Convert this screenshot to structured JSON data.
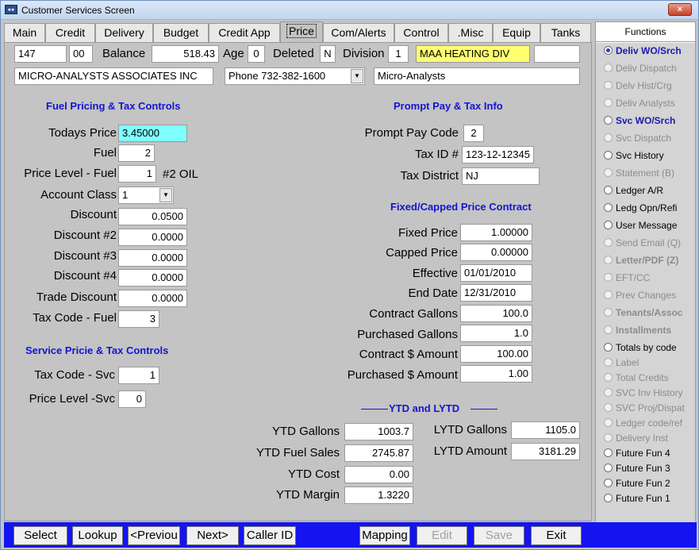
{
  "window": {
    "title": "Customer Services Screen",
    "close": "×"
  },
  "tabs": [
    {
      "label": "Main"
    },
    {
      "label": "Credit"
    },
    {
      "label": "Delivery"
    },
    {
      "label": "Budget"
    },
    {
      "label": "Credit App"
    },
    {
      "label": "Price"
    },
    {
      "label": "Com/Alerts"
    },
    {
      "label": "Control"
    },
    {
      "label": ".Misc"
    },
    {
      "label": "Equip"
    },
    {
      "label": "Tanks"
    }
  ],
  "active_tab": "Price",
  "header": {
    "account": "147",
    "sub": "00",
    "balance_label": "Balance",
    "balance": "518.43",
    "age_label": "Age",
    "age": "0",
    "deleted_label": "Deleted",
    "deleted": "N",
    "division_label": "Division",
    "division": "1",
    "division_name": "MAA HEATING  DIV",
    "customer_name": "MICRO-ANALYSTS ASSOCIATES INC",
    "phone": "Phone 732-382-1600",
    "short_name": "Micro-Analysts"
  },
  "fuel": {
    "heading": "Fuel Pricing & Tax Controls",
    "todays_price_label": "Todays Price",
    "todays_price": "3.45000",
    "fuel_label": "Fuel",
    "fuel": "2",
    "price_level_label": "Price Level - Fuel",
    "price_level": "1",
    "fuel_name": "#2 OIL",
    "account_class_label": "Account Class",
    "account_class": "1",
    "discount_label": "Discount",
    "discount": "0.0500",
    "discount2_label": "Discount #2",
    "discount2": "0.0000",
    "discount3_label": "Discount #3",
    "discount3": "0.0000",
    "discount4_label": "Discount #4",
    "discount4": "0.0000",
    "trade_discount_label": "Trade Discount",
    "trade_discount": "0.0000",
    "tax_code_label": "Tax Code - Fuel",
    "tax_code": "3"
  },
  "service": {
    "heading": "Service Pricie & Tax Controls",
    "tax_code_label": "Tax Code - Svc",
    "tax_code": "1",
    "price_level_label": "Price Level -Svc",
    "price_level": "0"
  },
  "prompt": {
    "heading": "Prompt Pay & Tax Info",
    "code_label": "Prompt Pay Code",
    "code": "2",
    "tax_id_label": "Tax ID #",
    "tax_id": "123-12-12345",
    "tax_district_label": "Tax District",
    "tax_district": "NJ"
  },
  "contract": {
    "heading": "Fixed/Capped Price Contract",
    "fixed_label": "Fixed Price",
    "fixed": "1.00000",
    "capped_label": "Capped Price",
    "capped": "0.00000",
    "effective_label": "Effective",
    "effective": "01/01/2010",
    "end_label": "End Date",
    "end": "12/31/2010",
    "gallons_label": "Contract Gallons",
    "gallons": "100.0",
    "purchased_gallons_label": "Purchased Gallons",
    "purchased_gallons": "1.0",
    "amount_label": "Contract $ Amount",
    "amount": "100.00",
    "purchased_amount_label": "Purchased $ Amount",
    "purchased_amount": "1.00"
  },
  "ytd": {
    "heading": "YTD and LYTD",
    "gallons_label": "YTD Gallons",
    "gallons": "1003.7",
    "fuel_sales_label": "YTD Fuel Sales",
    "fuel_sales": "2745.87",
    "cost_label": "YTD Cost",
    "cost": "0.00",
    "margin_label": "YTD Margin",
    "margin": "1.3220",
    "lytd_gallons_label": "LYTD Gallons",
    "lytd_gallons": "1105.0",
    "lytd_amount_label": "LYTD Amount",
    "lytd_amount": "3181.29"
  },
  "functions": {
    "title": "Functions",
    "items": [
      {
        "label": "Deliv WO/Srch"
      },
      {
        "label": "Deliv Dispatch"
      },
      {
        "label": "Delv Hist/Crg"
      },
      {
        "label": "Deliv Analysts"
      },
      {
        "label": "Svc WO/Srch"
      },
      {
        "label": "Svc Dispatch"
      },
      {
        "label": "Svc History"
      },
      {
        "label": "Statement (B)"
      },
      {
        "label": "Ledger A/R"
      },
      {
        "label": "Ledg Opn/Refi"
      },
      {
        "label": "User Message"
      },
      {
        "label": "Send Email (Q)"
      },
      {
        "label": "Letter/PDF (Z)"
      },
      {
        "label": "EFT/CC"
      },
      {
        "label": "Prev Changes"
      },
      {
        "label": "Tenants/Assoc"
      },
      {
        "label": "Installments"
      },
      {
        "label": "Totals by code"
      },
      {
        "label": "Label"
      },
      {
        "label": "Total Credits"
      },
      {
        "label": "SVC Inv History"
      },
      {
        "label": "SVC Proj/Dispat"
      },
      {
        "label": "Ledger code/ref"
      },
      {
        "label": "Delivery Inst"
      },
      {
        "label": "Future Fun 4"
      },
      {
        "label": "Future Fun 3"
      },
      {
        "label": "Future Fun 2"
      },
      {
        "label": "Future Fun 1"
      }
    ]
  },
  "buttons": {
    "select": "Select",
    "lookup": "Lookup",
    "previous": "<Previou",
    "next": "Next>",
    "caller_id": "Caller ID",
    "mapping": "Mapping",
    "edit": "Edit",
    "save": "Save",
    "exit": "Exit"
  }
}
